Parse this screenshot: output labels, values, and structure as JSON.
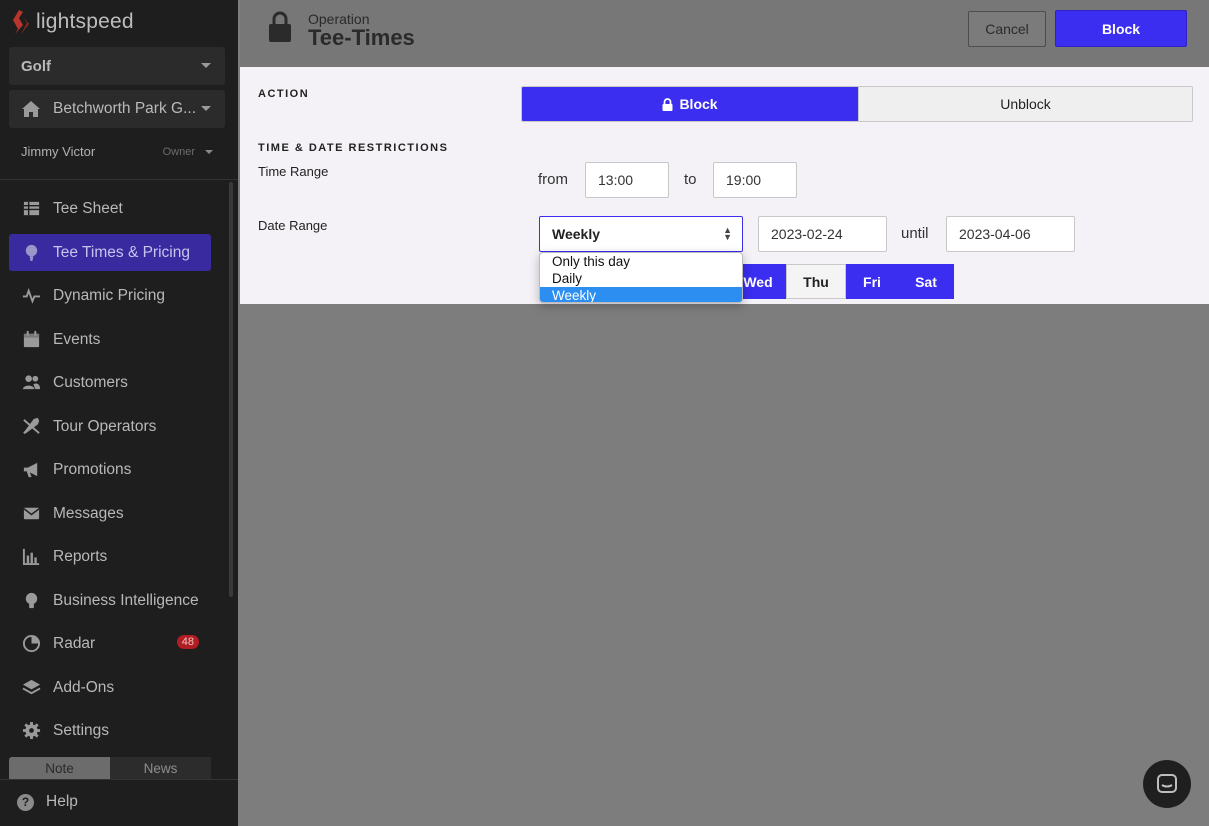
{
  "brand": {
    "name": "lightspeed",
    "accent": "#3b2ef0",
    "logo_color": "#c0392b"
  },
  "sidebar": {
    "sport_select": "Golf",
    "course_select": "Betchworth Park G...",
    "user": {
      "name": "Jimmy Victor",
      "role": "Owner"
    },
    "nav": [
      {
        "label": "Tee Sheet",
        "icon": "table-icon"
      },
      {
        "label": "Tee Times & Pricing",
        "icon": "golf-tee-icon",
        "active": true
      },
      {
        "label": "Dynamic Pricing",
        "icon": "pulse-icon"
      },
      {
        "label": "Events",
        "icon": "calendar-icon"
      },
      {
        "label": "Customers",
        "icon": "users-icon"
      },
      {
        "label": "Tour Operators",
        "icon": "plane-icon"
      },
      {
        "label": "Promotions",
        "icon": "megaphone-icon"
      },
      {
        "label": "Messages",
        "icon": "envelope-icon"
      },
      {
        "label": "Reports",
        "icon": "bar-chart-icon"
      },
      {
        "label": "Business Intelligence",
        "icon": "lightbulb-icon"
      },
      {
        "label": "Radar",
        "icon": "radar-icon",
        "badge": "48"
      },
      {
        "label": "Add-Ons",
        "icon": "layers-icon"
      },
      {
        "label": "Settings",
        "icon": "gear-icon"
      }
    ],
    "bottom_tabs": {
      "note": "Note",
      "news": "News"
    },
    "help": "Help"
  },
  "header": {
    "subtitle": "Operation",
    "title": "Tee-Times",
    "cancel_label": "Cancel",
    "block_label": "Block"
  },
  "form": {
    "action_label": "ACTION",
    "action_options": {
      "block": "Block",
      "unblock": "Unblock",
      "selected": "Block"
    },
    "restrictions_label": "TIME & DATE RESTRICTIONS",
    "time_range": {
      "label": "Time Range",
      "from_text": "from",
      "from_value": "13:00",
      "to_text": "to",
      "to_value": "19:00"
    },
    "date_range": {
      "label": "Date Range",
      "frequency": "Weekly",
      "start": "2023-02-24",
      "until_text": "until",
      "end": "2023-04-06",
      "dropdown_options": [
        "Only this day",
        "Daily",
        "Weekly"
      ],
      "dropdown_selected": "Weekly"
    },
    "weekdays": [
      {
        "label": "Wed",
        "selected": true
      },
      {
        "label": "Thu",
        "selected": false
      },
      {
        "label": "Fri",
        "selected": true
      },
      {
        "label": "Sat",
        "selected": true
      }
    ]
  }
}
